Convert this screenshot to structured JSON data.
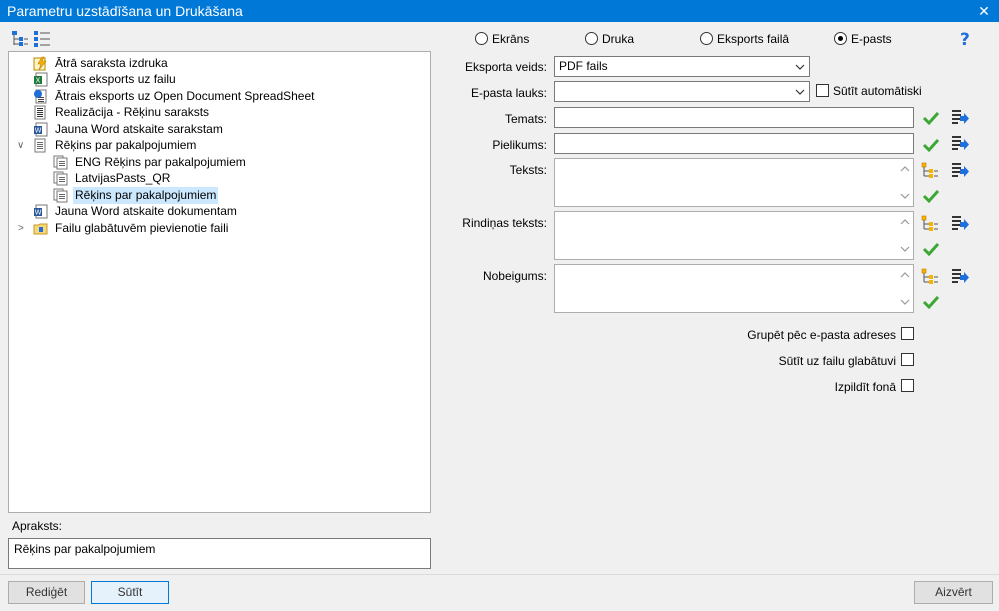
{
  "window": {
    "title": "Parametru uzstādīšana un Drukāšana"
  },
  "tree": {
    "items": [
      {
        "label": "Ātrā saraksta izdruka",
        "icon": "quick-print-icon"
      },
      {
        "label": "Ātrais eksports uz failu",
        "icon": "excel-icon"
      },
      {
        "label": "Ātrais eksports uz Open Document SpreadSheet",
        "icon": "ods-icon"
      },
      {
        "label": "Realizācija - Rēķinu saraksts",
        "icon": "report-icon"
      },
      {
        "label": "Jauna Word atskaite sarakstam",
        "icon": "word-icon"
      },
      {
        "label": "Rēķins par pakalpojumiem",
        "icon": "document-icon"
      },
      {
        "label": "ENG Rēķins par pakalpojumiem",
        "icon": "document-icon"
      },
      {
        "label": "LatvijasPasts_QR",
        "icon": "document-icon"
      },
      {
        "label": "Rēķins par pakalpojumiem",
        "icon": "document-icon"
      },
      {
        "label": "Jauna Word atskaite dokumentam",
        "icon": "word-icon"
      },
      {
        "label": "Failu glabātuvēm pievienotie faili",
        "icon": "folder-icon"
      }
    ]
  },
  "description": {
    "label": "Apraksts:",
    "value": "Rēķins par pakalpojumiem"
  },
  "buttons": {
    "edit": "Rediģēt",
    "send": "Sūtīt",
    "close": "Aizvērt"
  },
  "output_modes": {
    "screen": "Ekrāns",
    "print": "Druka",
    "export": "Eksports failā",
    "email": "E-pasts",
    "selected": "E-pasts"
  },
  "form": {
    "export_type_label": "Eksporta veids:",
    "export_type_value": "PDF fails",
    "email_field_label": "E-pasta lauks:",
    "email_field_value": "",
    "auto_send_label": "Sūtīt automātiski",
    "subject_label": "Temats:",
    "attachment_label": "Pielikums:",
    "text_label": "Teksts:",
    "row_text_label": "Rindiņas teksts:",
    "ending_label": "Nobeigums:",
    "group_by_email_label": "Grupēt pēc e-pasta adreses",
    "send_to_storage_label": "Sūtīt uz failu glabātuvi",
    "run_background_label": "Izpildīt fonā"
  },
  "colors": {
    "titlebar": "#0078d7",
    "selection": "#cce8ff",
    "check_green": "#3aa832",
    "arrow_blue": "#1e6fd9"
  }
}
